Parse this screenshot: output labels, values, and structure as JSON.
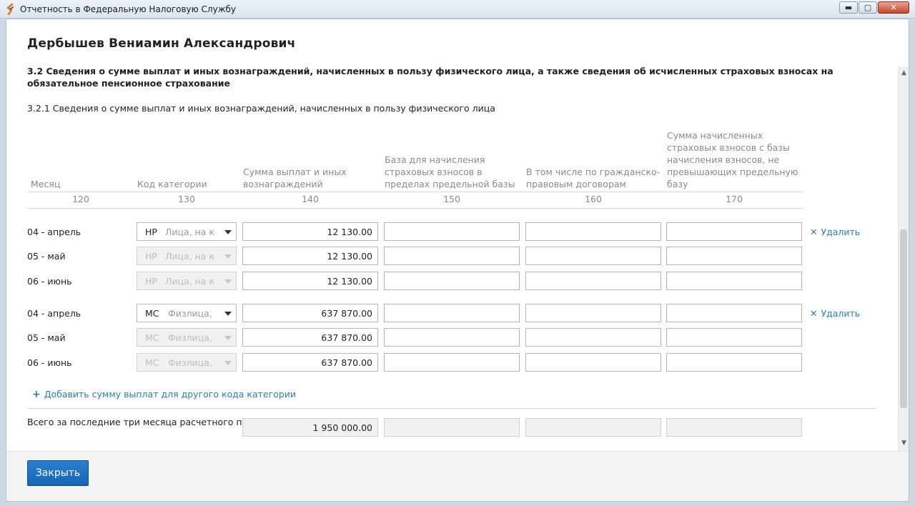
{
  "window": {
    "title": "Отчетность в Федеральную Налоговую Службу",
    "minimize": "▬",
    "maximize": "▢",
    "close": "✕"
  },
  "person": {
    "name": "Дербышев Вениамин Александрович"
  },
  "section": {
    "title": "3.2 Сведения о сумме выплат и иных вознаграждений, начисленных в пользу физического лица, а также сведения об исчисленных страховых взносах на обязательное пенсионное страхование",
    "subtitle": "3.2.1 Сведения о сумме выплат и иных вознаграждений, начисленных в пользу физического лица"
  },
  "columns": [
    {
      "label": "Месяц",
      "num": "120"
    },
    {
      "label": "Код категории",
      "num": "130"
    },
    {
      "label": "Сумма выплат и иных вознаграждений",
      "num": "140"
    },
    {
      "label": "База для начисления страховых взносов в пределах предельной базы",
      "num": "150"
    },
    {
      "label": "В том числе по гражданско-правовым договорам",
      "num": "160"
    },
    {
      "label": "Сумма начисленных страховых взносов с базы начисления взносов, не превышающих предельную базу",
      "num": "170"
    }
  ],
  "groups": [
    {
      "delete_label": "Удалить",
      "rows": [
        {
          "month": "04 - апрель",
          "code": "НР",
          "desc": "Лица, на кото",
          "amount": "12 130.00"
        },
        {
          "month": "05 - май",
          "code": "НР",
          "desc": "Лица, на кото",
          "amount": "12 130.00"
        },
        {
          "month": "06 - июнь",
          "code": "НР",
          "desc": "Лица, на кото",
          "amount": "12 130.00"
        }
      ]
    },
    {
      "delete_label": "Удалить",
      "rows": [
        {
          "month": "04 - апрель",
          "code": "МС",
          "desc": "Физлица, с",
          "amount": "637 870.00"
        },
        {
          "month": "05 - май",
          "code": "МС",
          "desc": "Физлица, с",
          "amount": "637 870.00"
        },
        {
          "month": "06 - июнь",
          "code": "МС",
          "desc": "Физлица, с",
          "amount": "637 870.00"
        }
      ]
    }
  ],
  "add_category_label": "Добавить сумму выплат для другого кода категории",
  "total": {
    "label": "Всего за последние три месяца расчетного периода",
    "amount": "1 950 000.00"
  },
  "footer": {
    "close_label": "Закрыть"
  }
}
